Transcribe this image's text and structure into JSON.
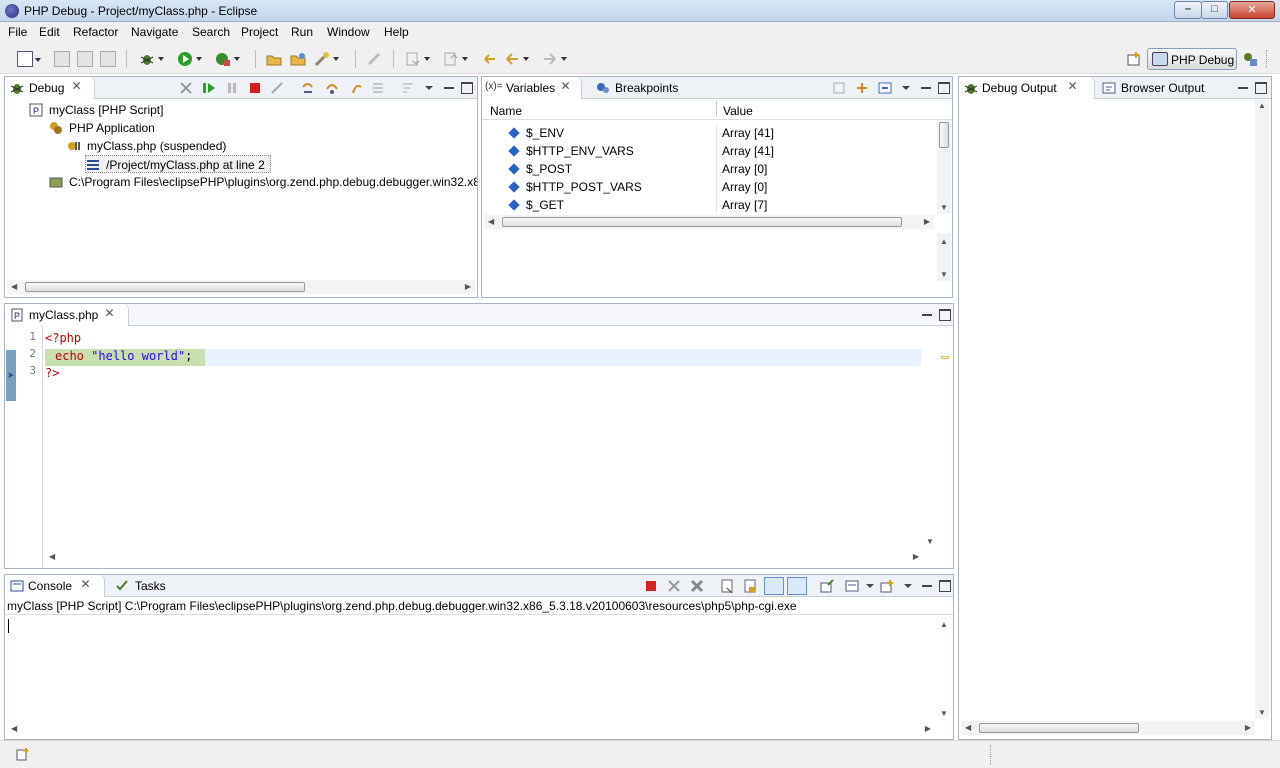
{
  "window": {
    "title": "PHP Debug - Project/myClass.php - Eclipse"
  },
  "menu": [
    "File",
    "Edit",
    "Refactor",
    "Navigate",
    "Search",
    "Project",
    "Run",
    "Window",
    "Help"
  ],
  "perspective": {
    "label": "PHP Debug"
  },
  "debug_view": {
    "tab_label": "Debug",
    "tree": [
      {
        "label": "myClass [PHP Script]",
        "level": 0,
        "icon": "php-script-icon"
      },
      {
        "label": "PHP Application",
        "level": 1,
        "icon": "php-application-icon"
      },
      {
        "label": "myClass.php (suspended)",
        "level": 2,
        "icon": "thread-suspended-icon"
      },
      {
        "label": "/Project/myClass.php at line 2",
        "level": 3,
        "icon": "stack-frame-icon"
      },
      {
        "label": "C:\\Program Files\\eclipsePHP\\plugins\\org.zend.php.debug.debugger.win32.x8",
        "level": 1,
        "icon": "process-icon"
      }
    ]
  },
  "variables_view": {
    "tabs": [
      "Variables",
      "Breakpoints"
    ],
    "columns": [
      "Name",
      "Value"
    ],
    "rows": [
      {
        "name": "$_ENV",
        "value": "Array [41]"
      },
      {
        "name": "$HTTP_ENV_VARS",
        "value": "Array [41]"
      },
      {
        "name": "$_POST",
        "value": "Array [0]"
      },
      {
        "name": "$HTTP_POST_VARS",
        "value": "Array [0]"
      },
      {
        "name": "$_GET",
        "value": "Array [7]"
      }
    ]
  },
  "output_view": {
    "tabs": [
      "Debug Output",
      "Browser Output"
    ]
  },
  "editor": {
    "tab_label": "myClass.php",
    "line_numbers": [
      "1",
      "2",
      "3"
    ],
    "lines": {
      "l1": "<?php",
      "l2_kw": "echo",
      "l2_str": "\"hello world\"",
      "l2_end": ";",
      "l3": "?>"
    },
    "current_line": 2
  },
  "console": {
    "tabs": [
      "Console",
      "Tasks"
    ],
    "process_path": "myClass [PHP Script] C:\\Program Files\\eclipsePHP\\plugins\\org.zend.php.debug.debugger.win32.x86_5.3.18.v20100603\\resources\\php5\\php-cgi.exe"
  },
  "colors": {
    "keyword": "#c00000",
    "string": "#2a00ff",
    "current_line": "#e8f2fe",
    "terminate": "#d42020",
    "resume": "#2aa02a"
  }
}
